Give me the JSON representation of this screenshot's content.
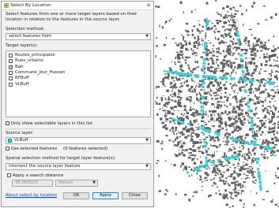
{
  "dialog": {
    "title": "Select By Location",
    "close_glyph": "✕",
    "description": "Select features from one or more target layers based on their location in relation to the features in the source layer.",
    "selection_method_label": "Selection method:",
    "selection_method_value": "select features from",
    "target_layers_label": "Target layer(s):",
    "target_layers": [
      {
        "name": "Routes_principales",
        "checked": false
      },
      {
        "name": "Rues_urbains",
        "checked": false
      },
      {
        "name": "Bati",
        "checked": true
      },
      {
        "name": "Commune_Jour_Hussen",
        "checked": false
      },
      {
        "name": "RFBuff",
        "checked": false
      },
      {
        "name": "VLBuff",
        "checked": false
      }
    ],
    "only_selectable_label": "Only show selectable layers in this list",
    "source_layer_label": "Source layer:",
    "source_layer_value": "VLBuff",
    "use_selected_label": "Use selected features",
    "features_selected_text": "(0 features selected)",
    "spatial_method_label": "Spatial selection method for target layer feature(s):",
    "spatial_method_value": "intersect the source layer feature",
    "search_distance_label": "Apply a search distance",
    "search_distance_value": "45.000000",
    "search_distance_unit": "Meters",
    "about_link": "About select by location",
    "ok_label": "OK",
    "apply_label": "Apply",
    "close_label": "Close"
  },
  "icons": {
    "title": "select-by-location-icon",
    "source_layer": "polygon-layer-icon",
    "dropdown": "chevron-down-icon"
  },
  "colors": {
    "buildings": "#5f5f5f",
    "selected_buffers": "#33d2df",
    "background": "#ffffff"
  }
}
